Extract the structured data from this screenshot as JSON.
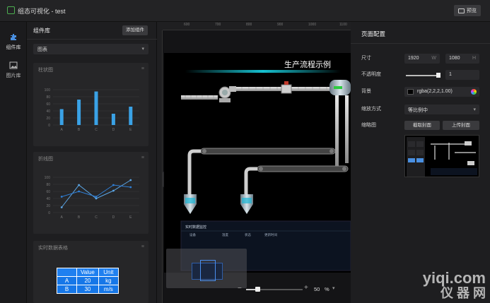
{
  "app": {
    "title": "组态可视化 - test",
    "preview_label": "预览"
  },
  "rail": [
    {
      "label": "组件库"
    },
    {
      "label": "图片库"
    }
  ],
  "library": {
    "title": "组件库",
    "add_label": "添加组件",
    "category": "图表",
    "bar_card_title": "柱状图",
    "line_card_title": "折线图",
    "table_card_title": "实时数据表格"
  },
  "chart_data": [
    {
      "type": "bar",
      "title": "",
      "categories": [
        "A",
        "B",
        "C",
        "D",
        "E"
      ],
      "values": [
        45,
        72,
        95,
        32,
        52
      ],
      "yticks": [
        "100",
        "80",
        "60",
        "40",
        "20",
        "0"
      ],
      "ylim": [
        0,
        100
      ]
    },
    {
      "type": "line",
      "title": "",
      "categories": [
        "A",
        "B",
        "C",
        "D",
        "E"
      ],
      "series": [
        {
          "values": [
            15,
            78,
            40,
            62,
            92
          ]
        },
        {
          "values": [
            45,
            60,
            45,
            78,
            72
          ]
        }
      ],
      "yticks": [
        "100",
        "80",
        "60",
        "40",
        "20",
        "0"
      ],
      "ylim": [
        0,
        100
      ]
    },
    {
      "type": "table",
      "headers": [
        "",
        "Value",
        "Unit"
      ],
      "rows": [
        [
          "A",
          "20",
          "kg"
        ],
        [
          "B",
          "30",
          "m/s"
        ]
      ]
    }
  ],
  "canvas": {
    "title": "生产流程示例",
    "ruler_marks": [
      "600",
      "700",
      "800",
      "900",
      "1000",
      "1100"
    ],
    "panel_title": "实时数据监控",
    "panel_headers": [
      "设备",
      "温度",
      "状态",
      "更新时间"
    ],
    "zoom_value": "50",
    "zoom_unit": "%",
    "zoom_progress": 0.2
  },
  "config": {
    "title": "页面配置",
    "size_label": "尺寸",
    "width": "1920",
    "width_unit": "W",
    "height": "1080",
    "height_unit": "H",
    "opacity_label": "不透明度",
    "opacity_value": "1",
    "bg_label": "背景",
    "bg_value": "rgba(2,2,2,1.00)",
    "scale_label": "缩放方式",
    "scale_value": "等比例中",
    "thumb_label": "缩略图",
    "capture_label": "截取封面",
    "upload_label": "上传封面"
  },
  "watermark": {
    "line1": "yiqi.com",
    "line2": "仪 器 网"
  },
  "colors": {
    "accent": "#4a90e2",
    "bar": "#3aa2e6",
    "line1": "#5ba6e6",
    "line2": "#2f7fd6"
  }
}
